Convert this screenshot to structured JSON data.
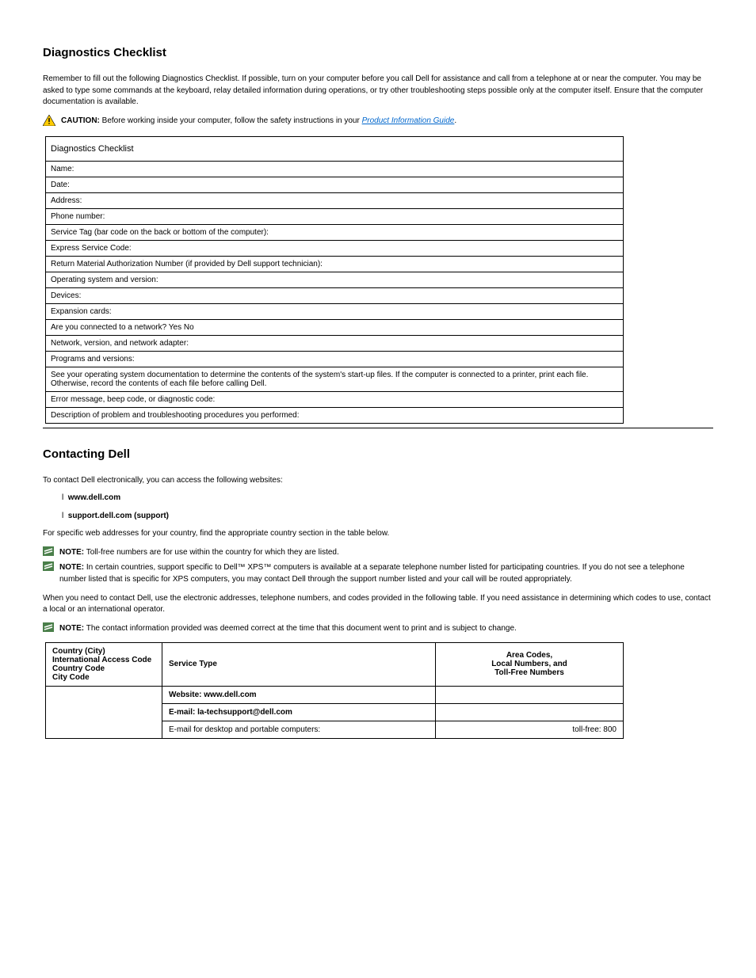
{
  "diag_title": "Diagnostics Checklist",
  "diag_p1_pre": "Remember to fill out the following Diagnostics Checklist. If possible, turn on your computer before you call Dell for assistance and call from a telephone at or near the computer. You may be asked to type some commands at the keyboard, relay detailed information during operations, or try other troubleshooting steps possible only at the computer itself. Ensure that the computer documentation is available.",
  "diag_p2": "",
  "safety_link_text": "Product Information Guide",
  "caution_label": "CAUTION:",
  "caution_text": "Before working inside your computer, follow the safety instructions in your ",
  "checklist": {
    "header": "Diagnostics Checklist",
    "rows": [
      "Name:",
      "Date:",
      "Address:",
      "Phone number:",
      "Service Tag (bar code on the back or bottom of the computer):",
      "Express Service Code:",
      "Return Material Authorization Number (if provided by Dell support technician):",
      "Operating system and version:",
      "Devices:",
      "Expansion cards:",
      "Are you connected to a network? Yes No",
      "Network, version, and network adapter:",
      "Programs and versions:",
      "See your operating system documentation to determine the contents of the system's start-up files. If the computer is connected to a printer, print each file. Otherwise, record the contents of each file before calling Dell.",
      "Error message, beep code, or diagnostic code:",
      "Description of problem and troubleshooting procedures you performed:"
    ]
  },
  "contact_title": "Contacting Dell",
  "contact_p1": "To contact Dell electronically, you can access the following websites:",
  "contact_bullets": [
    "www.dell.com",
    "support.dell.com (support)"
  ],
  "contact_p2": "For specific web addresses for your country, find the appropriate country section in the table below.",
  "note_label": "NOTE:",
  "note1": "Toll-free numbers are for use within the country for which they are listed.",
  "note2": "In certain countries, support specific to Dell™ XPS™ computers is available at a separate telephone number listed for participating countries. If you do not see a telephone number listed that is specific for XPS computers, you may contact Dell through the support number listed and your call will be routed appropriately.",
  "contact_p3": "When you need to contact Dell, use the electronic addresses, telephone numbers, and codes provided in the following table. If you need assistance in determining which codes to use, contact a local or an international operator.",
  "note3": "The contact information provided was deemed correct at the time that this document went to print and is subject to change.",
  "contact_table": {
    "headers": [
      "Country (City)\nInternational Access Code\nCountry Code\nCity Code",
      "Service Type",
      "Area Codes,\nLocal Numbers, and\nToll-Free Numbers"
    ],
    "rows": [
      {
        "area": "",
        "service": "Website: www.dell.com",
        "phone": ""
      },
      {
        "area": "",
        "service": "E-mail: la-techsupport@dell.com",
        "phone": ""
      },
      {
        "area": "",
        "service": "E-mail for desktop and portable computers:",
        "phone": "toll-free: 800"
      }
    ]
  }
}
